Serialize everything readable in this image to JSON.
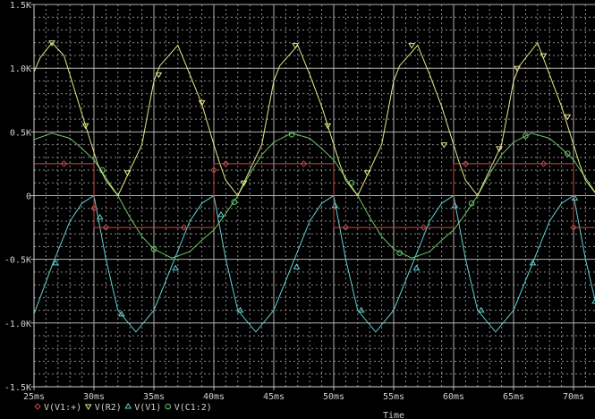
{
  "chart_data": {
    "type": "line",
    "title": "",
    "xlabel": "Time",
    "ylabel": "",
    "xlim": [
      25,
      71.8
    ],
    "ylim": [
      -1.5,
      1.5
    ],
    "x_unit": "ms",
    "y_unit": "K",
    "grid": true,
    "legend_placement": "bottom-left",
    "x_ticks": [
      {
        "value": 25,
        "label": "25ms"
      },
      {
        "value": 30,
        "label": "30ms"
      },
      {
        "value": 35,
        "label": "35ms"
      },
      {
        "value": 40,
        "label": "40ms"
      },
      {
        "value": 45,
        "label": "45ms"
      },
      {
        "value": 50,
        "label": "50ms"
      },
      {
        "value": 55,
        "label": "55ms"
      },
      {
        "value": 60,
        "label": "60ms"
      },
      {
        "value": 65,
        "label": "65ms"
      },
      {
        "value": 70,
        "label": "70ms"
      }
    ],
    "y_ticks": [
      {
        "value": 1.5,
        "label": "1.5K"
      },
      {
        "value": 1.0,
        "label": "1.0K"
      },
      {
        "value": 0.5,
        "label": "0.5K"
      },
      {
        "value": 0,
        "label": "0"
      },
      {
        "value": -0.5,
        "label": "-0.5K"
      },
      {
        "value": -1.0,
        "label": "-1.0K"
      },
      {
        "value": -1.5,
        "label": "-1.5K"
      }
    ],
    "series": [
      {
        "name": "V(V1:+)",
        "color": "#c84848",
        "marker": "diamond",
        "points": [
          [
            25,
            0.25
          ],
          [
            30,
            0.25
          ],
          [
            30,
            -0.25
          ],
          [
            40,
            -0.25
          ],
          [
            40,
            0.25
          ],
          [
            50,
            0.25
          ],
          [
            50,
            -0.25
          ],
          [
            60,
            -0.25
          ],
          [
            60,
            0.25
          ],
          [
            70,
            0.25
          ],
          [
            70,
            -0.25
          ],
          [
            72,
            -0.25
          ]
        ],
        "markers": [
          [
            27.5,
            0.25
          ],
          [
            30,
            -0.1
          ],
          [
            31,
            -0.25
          ],
          [
            37.5,
            -0.25
          ],
          [
            40,
            0.2
          ],
          [
            41,
            0.25
          ],
          [
            47.5,
            0.25
          ],
          [
            51,
            -0.25
          ],
          [
            57.5,
            -0.25
          ],
          [
            61,
            0.25
          ],
          [
            67.5,
            0.25
          ],
          [
            70,
            -0.25
          ]
        ]
      },
      {
        "name": "V(R2)",
        "color": "#e8e888",
        "marker": "triangle-down",
        "points": [
          [
            25,
            0.97
          ],
          [
            25.5,
            1.08
          ],
          [
            26.5,
            1.2
          ],
          [
            27.5,
            1.1
          ],
          [
            29.3,
            0.55
          ],
          [
            30.3,
            0.25
          ],
          [
            31,
            0.12
          ],
          [
            32,
            0
          ],
          [
            33,
            0.2
          ],
          [
            34,
            0.4
          ],
          [
            35,
            0.9
          ],
          [
            35.5,
            1.02
          ],
          [
            37,
            1.18
          ],
          [
            38,
            0.95
          ],
          [
            39,
            0.72
          ],
          [
            40,
            0.4
          ],
          [
            40.5,
            0.25
          ],
          [
            41,
            0.12
          ],
          [
            42,
            0
          ],
          [
            43,
            0.2
          ],
          [
            44,
            0.4
          ],
          [
            45,
            0.9
          ],
          [
            45.5,
            1.02
          ],
          [
            47,
            1.18
          ],
          [
            48,
            0.95
          ],
          [
            49,
            0.7
          ],
          [
            50,
            0.4
          ],
          [
            50.5,
            0.25
          ],
          [
            51,
            0.12
          ],
          [
            52,
            0
          ],
          [
            53,
            0.2
          ],
          [
            54,
            0.4
          ],
          [
            55,
            0.9
          ],
          [
            55.5,
            1.02
          ],
          [
            57,
            1.18
          ],
          [
            58,
            0.95
          ],
          [
            59,
            0.7
          ],
          [
            60,
            0.4
          ],
          [
            60.5,
            0.25
          ],
          [
            61,
            0.12
          ],
          [
            62,
            0
          ],
          [
            63,
            0.2
          ],
          [
            64,
            0.4
          ],
          [
            65,
            0.9
          ],
          [
            65.5,
            1.02
          ],
          [
            67,
            1.2
          ],
          [
            68,
            0.95
          ],
          [
            69,
            0.7
          ],
          [
            70,
            0.4
          ],
          [
            70.5,
            0.25
          ],
          [
            71,
            0.12
          ],
          [
            72,
            0
          ]
        ],
        "markers": [
          [
            26.5,
            1.2
          ],
          [
            29.3,
            0.55
          ],
          [
            32.8,
            0.18
          ],
          [
            35.4,
            0.95
          ],
          [
            39,
            0.73
          ],
          [
            42.5,
            0.1
          ],
          [
            46.8,
            1.18
          ],
          [
            49.5,
            0.55
          ],
          [
            52.8,
            0.18
          ],
          [
            56.5,
            1.18
          ],
          [
            59.2,
            0.4
          ],
          [
            63.8,
            0.37
          ],
          [
            65.3,
            1.0
          ],
          [
            67.5,
            1.1
          ],
          [
            69.5,
            0.62
          ]
        ]
      },
      {
        "name": "V(V1)",
        "color": "#60d0d0",
        "marker": "triangle-up",
        "points": [
          [
            25,
            -0.93
          ],
          [
            26.5,
            -0.55
          ],
          [
            28,
            -0.2
          ],
          [
            29,
            -0.06
          ],
          [
            30,
            0
          ],
          [
            30.3,
            -0.15
          ],
          [
            31,
            -0.5
          ],
          [
            32,
            -0.9
          ],
          [
            33.5,
            -1.07
          ],
          [
            35,
            -0.9
          ],
          [
            36.5,
            -0.55
          ],
          [
            38,
            -0.2
          ],
          [
            39,
            -0.06
          ],
          [
            40,
            0
          ],
          [
            40.3,
            -0.15
          ],
          [
            41,
            -0.5
          ],
          [
            42,
            -0.9
          ],
          [
            43.5,
            -1.07
          ],
          [
            45,
            -0.9
          ],
          [
            46.5,
            -0.55
          ],
          [
            48,
            -0.2
          ],
          [
            49,
            -0.06
          ],
          [
            50,
            0
          ],
          [
            50.3,
            -0.15
          ],
          [
            51,
            -0.5
          ],
          [
            52,
            -0.9
          ],
          [
            53.5,
            -1.07
          ],
          [
            55,
            -0.9
          ],
          [
            56.5,
            -0.55
          ],
          [
            58,
            -0.2
          ],
          [
            59,
            -0.06
          ],
          [
            60,
            0
          ],
          [
            60.3,
            -0.15
          ],
          [
            61,
            -0.5
          ],
          [
            62,
            -0.9
          ],
          [
            63.5,
            -1.07
          ],
          [
            65,
            -0.9
          ],
          [
            66.5,
            -0.55
          ],
          [
            68,
            -0.2
          ],
          [
            69,
            -0.06
          ],
          [
            70,
            0
          ],
          [
            70.3,
            -0.15
          ],
          [
            71,
            -0.5
          ],
          [
            72,
            -0.9
          ]
        ],
        "markers": [
          [
            26.8,
            -0.53
          ],
          [
            30.5,
            -0.17
          ],
          [
            32.3,
            -0.93
          ],
          [
            36.8,
            -0.57
          ],
          [
            40.6,
            -0.15
          ],
          [
            42.2,
            -0.9
          ],
          [
            46.9,
            -0.56
          ],
          [
            50.1,
            -0.08
          ],
          [
            52.3,
            -0.9
          ],
          [
            56.9,
            -0.57
          ],
          [
            60.1,
            -0.08
          ],
          [
            62.3,
            -0.9
          ],
          [
            66.6,
            -0.53
          ],
          [
            70.1,
            -0.02
          ],
          [
            71.8,
            -0.83
          ]
        ]
      },
      {
        "name": "V(C1:2)",
        "color": "#68c868",
        "marker": "circle",
        "points": [
          [
            25,
            0.44
          ],
          [
            26.5,
            0.49
          ],
          [
            28,
            0.45
          ],
          [
            29,
            0.37
          ],
          [
            30,
            0.28
          ],
          [
            31,
            0.14
          ],
          [
            32,
            0
          ],
          [
            33,
            -0.17
          ],
          [
            34,
            -0.32
          ],
          [
            35,
            -0.42
          ],
          [
            36.5,
            -0.49
          ],
          [
            38,
            -0.44
          ],
          [
            39,
            -0.35
          ],
          [
            40,
            -0.27
          ],
          [
            41,
            -0.14
          ],
          [
            42,
            0
          ],
          [
            43,
            0.17
          ],
          [
            44,
            0.32
          ],
          [
            45,
            0.42
          ],
          [
            46.5,
            0.49
          ],
          [
            48,
            0.45
          ],
          [
            49,
            0.37
          ],
          [
            50,
            0.28
          ],
          [
            51,
            0.14
          ],
          [
            52,
            0
          ],
          [
            53,
            -0.17
          ],
          [
            54,
            -0.32
          ],
          [
            55,
            -0.42
          ],
          [
            56.5,
            -0.49
          ],
          [
            58,
            -0.44
          ],
          [
            59,
            -0.35
          ],
          [
            60,
            -0.27
          ],
          [
            61,
            -0.14
          ],
          [
            62,
            0
          ],
          [
            63,
            0.17
          ],
          [
            64,
            0.32
          ],
          [
            65,
            0.42
          ],
          [
            66.5,
            0.49
          ],
          [
            68,
            0.45
          ],
          [
            69,
            0.37
          ],
          [
            70,
            0.28
          ],
          [
            71,
            0.14
          ],
          [
            72,
            0
          ]
        ],
        "markers": [
          [
            30.7,
            0.2
          ],
          [
            35,
            -0.42
          ],
          [
            41.7,
            -0.05
          ],
          [
            46.5,
            0.48
          ],
          [
            51.5,
            0.1
          ],
          [
            55.5,
            -0.45
          ],
          [
            61.5,
            -0.06
          ],
          [
            66,
            0.47
          ],
          [
            69.5,
            0.33
          ]
        ]
      }
    ]
  }
}
